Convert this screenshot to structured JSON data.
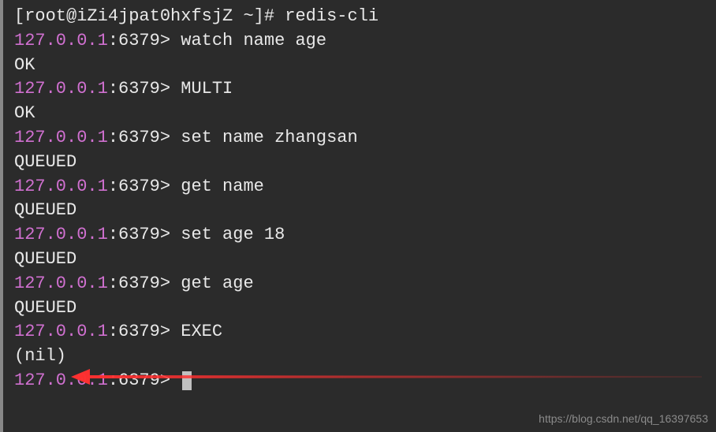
{
  "shell": {
    "user": "root",
    "host": "iZi4jpat0hxfsjZ",
    "path": "~",
    "symbol": "#",
    "command": "redis-cli"
  },
  "redis": {
    "ip": "127.0.0.1",
    "port": "6379"
  },
  "lines": {
    "l1_cmd": "watch name age",
    "l1_res": "OK",
    "l2_cmd": "MULTI",
    "l2_res": "OK",
    "l3_cmd": "set name zhangsan",
    "l3_res": "QUEUED",
    "l4_cmd": "get name",
    "l4_res": "QUEUED",
    "l5_cmd": "set age 18",
    "l5_res": "QUEUED",
    "l6_cmd": "get age",
    "l6_res": "QUEUED",
    "l7_cmd": "EXEC",
    "l7_res": "(nil)"
  },
  "watermark": "https://blog.csdn.net/qq_16397653"
}
